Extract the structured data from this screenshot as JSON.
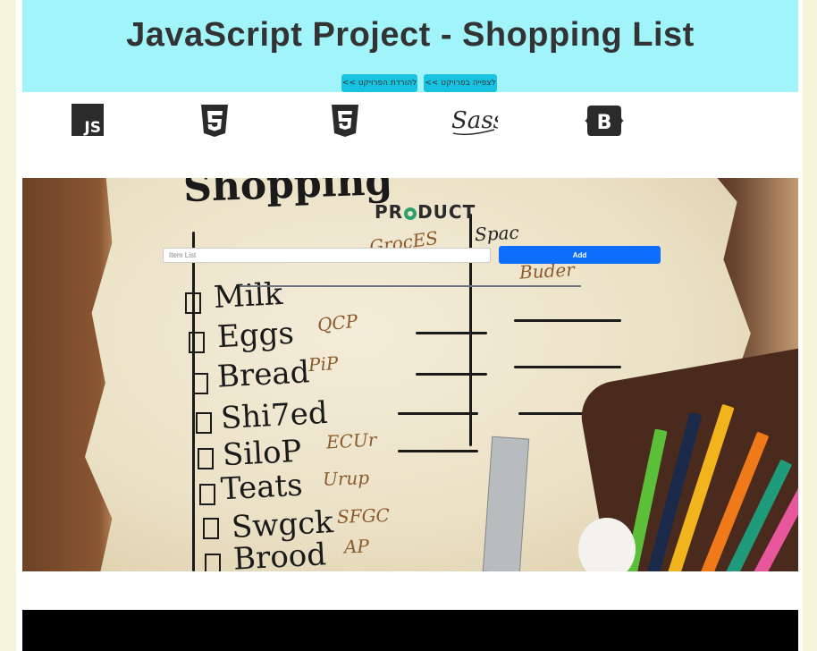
{
  "header": {
    "title": "JavaScript Project - Shopping List",
    "view_button": "לצפייה בפרויקט >>",
    "download_button": "להורדת הפרויקט >>"
  },
  "tech_logos": [
    {
      "name": "javascript-logo",
      "label": "JS"
    },
    {
      "name": "css3-logo",
      "label": "3"
    },
    {
      "name": "html5-logo",
      "label": "5"
    },
    {
      "name": "sass-logo",
      "label": "Sass"
    },
    {
      "name": "bootstrap-logo",
      "label": "B"
    }
  ],
  "app": {
    "logo_text_pre": "PR",
    "logo_text_post": "DUCT",
    "input_placeholder": "Item List",
    "add_button": "Add"
  },
  "hero_paper": {
    "heading": "Shopping",
    "items": [
      "Milk",
      "Eggs",
      "Bread",
      "Shi7ed",
      "SiloP",
      "Teats",
      "Swgck",
      "Brood"
    ],
    "notes": [
      "GrocES",
      "QCP",
      "PiP",
      "ECUr",
      "Urup",
      "SFGC",
      "AP",
      "Spac",
      "Buder"
    ]
  },
  "colors": {
    "header_bg": "#a1f5fa",
    "header_button": "#18c3e2",
    "add_button": "#0d6efd",
    "page_bg": "#f5f5dc"
  }
}
